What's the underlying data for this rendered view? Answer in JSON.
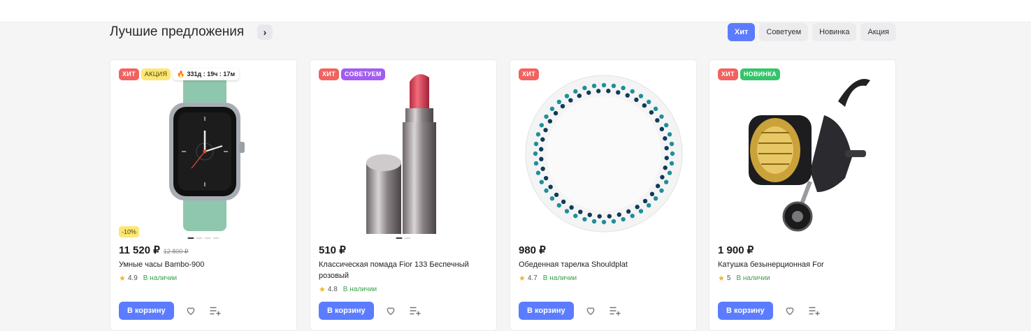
{
  "section": {
    "title": "Лучшие предложения",
    "arrow_glyph": "›",
    "filters": [
      "Хит",
      "Советуем",
      "Новинка",
      "Акция"
    ]
  },
  "colors": {
    "accent": "#5b7cff",
    "hit": "#f2625f",
    "sale": "#fde776",
    "recommend": "#a25cf2",
    "new": "#35c46a",
    "in_stock": "#3aa04a"
  },
  "products": [
    {
      "badges": [
        "ХИТ",
        "АКЦИЯ"
      ],
      "timer": "331д : 19ч : 17м",
      "discount": "-10%",
      "price": "11 520 ₽",
      "old_price": "12 800 ₽",
      "name": "Умные часы Bambo-900",
      "rating": "4.9",
      "stock": "В наличии",
      "cart_label": "В корзину",
      "image_icon": "smartwatch-image"
    },
    {
      "badges": [
        "ХИТ",
        "СОВЕТУЕМ"
      ],
      "price": "510 ₽",
      "name": "Классическая помада Fior 133 Беспечный розовый",
      "rating": "4.8",
      "stock": "В наличии",
      "cart_label": "В корзину",
      "image_icon": "lipstick-image"
    },
    {
      "badges": [
        "ХИТ"
      ],
      "price": "980 ₽",
      "name": "Обеденная тарелка Shouldplat",
      "rating": "4.7",
      "stock": "В наличии",
      "cart_label": "В корзину",
      "image_icon": "plate-image"
    },
    {
      "badges": [
        "ХИТ",
        "НОВИНКА"
      ],
      "price": "1 900 ₽",
      "name": "Катушка безынерционная For",
      "rating": "5",
      "stock": "В наличии",
      "cart_label": "В корзину",
      "image_icon": "fishing-reel-image"
    }
  ]
}
